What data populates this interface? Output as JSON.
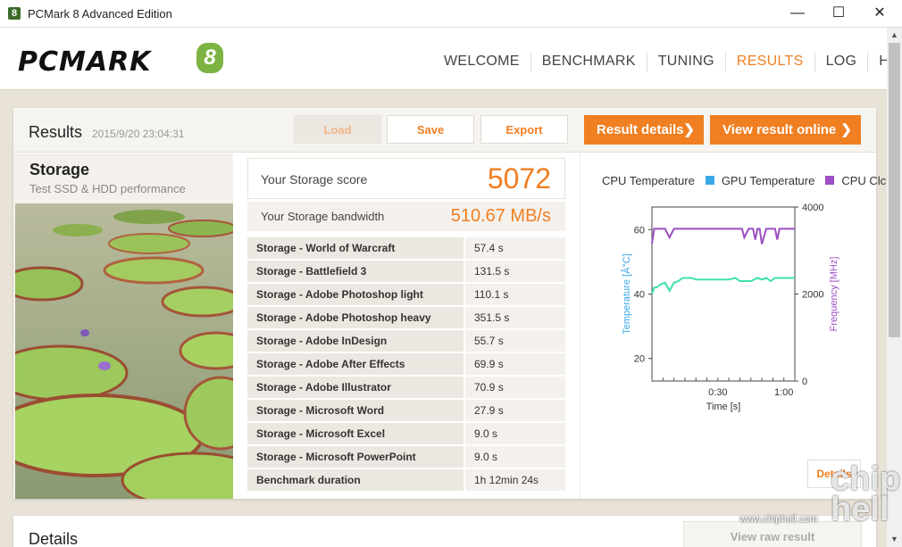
{
  "window": {
    "title": "PCMark 8 Advanced Edition",
    "app_icon": "8",
    "minimize": "—",
    "maximize": "☐",
    "close": "✕"
  },
  "header": {
    "logo_text": "PCMARK",
    "logo_num": "8",
    "nav": [
      "WELCOME",
      "BENCHMARK",
      "TUNING",
      "RESULTS",
      "LOG",
      "HELP"
    ],
    "active_nav": "RESULTS"
  },
  "results": {
    "title": "Results",
    "date": "2015/9/20 23:04:31",
    "load_label": "Load",
    "save_label": "Save",
    "export_label": "Export",
    "result_details_label": "Result details",
    "view_online_label": "View result online",
    "chevron": "❯"
  },
  "storage": {
    "title": "Storage",
    "subtitle": "Test SSD & HDD performance"
  },
  "score": {
    "label": "Your Storage score",
    "value": "5072",
    "bw_label": "Your Storage bandwidth",
    "bw_value": "510.67 MB/s"
  },
  "subtests": [
    {
      "name": "Storage - World of Warcraft",
      "value": "57.4 s"
    },
    {
      "name": "Storage - Battlefield 3",
      "value": "131.5 s"
    },
    {
      "name": "Storage - Adobe Photoshop light",
      "value": "110.1 s"
    },
    {
      "name": "Storage - Adobe Photoshop heavy",
      "value": "351.5 s"
    },
    {
      "name": "Storage - Adobe InDesign",
      "value": "55.7 s"
    },
    {
      "name": "Storage - Adobe After Effects",
      "value": "69.9 s"
    },
    {
      "name": "Storage - Adobe Illustrator",
      "value": "70.9 s"
    },
    {
      "name": "Storage - Microsoft Word",
      "value": "27.9 s"
    },
    {
      "name": "Storage - Microsoft Excel",
      "value": "9.0 s"
    },
    {
      "name": "Storage - Microsoft PowerPoint",
      "value": "9.0 s"
    },
    {
      "name": "Benchmark duration",
      "value": "1h 12min 24s"
    }
  ],
  "chart_data": {
    "type": "line",
    "legend": [
      {
        "name": "CPU Temperature",
        "color": "#ffffff"
      },
      {
        "name": "GPU Temperature",
        "color": "#3aa7e6"
      },
      {
        "name": "CPU Clc",
        "color": "#9b4fc3"
      }
    ],
    "xlabel": "Time [s]",
    "ylabel_left": "Temperature [Â°C]",
    "ylabel_right": "Frequency [MHz]",
    "x_ticks": [
      "0:30",
      "1:00"
    ],
    "x_range": [
      0,
      65
    ],
    "ylim_left": [
      13,
      67
    ],
    "yticks_left": [
      20,
      40,
      60
    ],
    "ylim_right": [
      0,
      4000
    ],
    "yticks_right": [
      0,
      2000,
      4000
    ],
    "series": [
      {
        "name": "CPU Temperature",
        "color": "#3fe0b0",
        "axis": "left",
        "x": [
          0,
          1,
          2,
          4,
          6,
          8,
          10,
          12,
          14,
          16,
          18,
          20,
          25,
          30,
          35,
          38,
          40,
          45,
          48,
          50,
          52,
          54,
          56,
          60,
          65
        ],
        "y": [
          40,
          42,
          42,
          43,
          43.5,
          41,
          43.5,
          44,
          45,
          45,
          45,
          44.5,
          44.5,
          44.5,
          44.5,
          45,
          44,
          44,
          45,
          44.5,
          45,
          44,
          45,
          45,
          45
        ]
      },
      {
        "name": "CPU Clc",
        "color": "#9b4fc3",
        "axis": "right",
        "x": [
          0,
          1,
          2,
          6,
          8,
          10,
          12,
          14,
          40,
          41,
          42,
          44,
          46,
          47,
          48,
          49,
          50,
          52,
          54,
          56,
          57,
          58,
          62,
          65
        ],
        "y": [
          3150,
          3500,
          3500,
          3500,
          3300,
          3500,
          3500,
          3500,
          3500,
          3500,
          3300,
          3500,
          3500,
          3250,
          3500,
          3500,
          3150,
          3500,
          3500,
          3500,
          3250,
          3500,
          3500,
          3500
        ]
      }
    ]
  },
  "details_btn_label": "Details",
  "details": {
    "title": "Details",
    "raw_label": "View raw result"
  },
  "watermark": {
    "url": "www.chiphell.com",
    "brand": "chip hell"
  }
}
